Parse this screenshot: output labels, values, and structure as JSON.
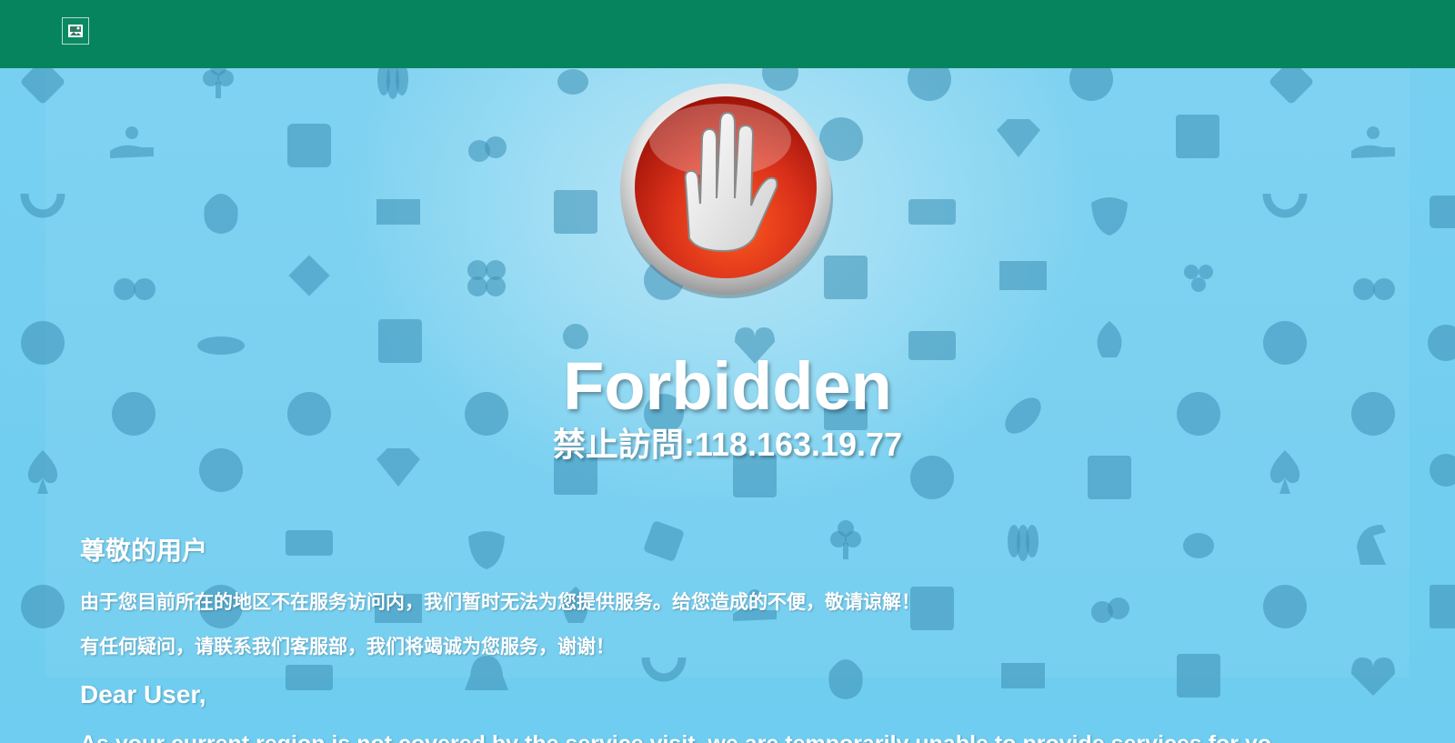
{
  "header": {
    "logo_icon": "broken-image-icon",
    "bar_color": "#06845e"
  },
  "background": {
    "pattern_icons": [
      "dice-icon",
      "club-icon",
      "bowling-icon",
      "lemon-icon",
      "eight-ball-icon",
      "yen-coin-icon",
      "poker-chip-icon",
      "coin-hand-icon",
      "cherries-icon",
      "tennis-ball-icon",
      "diamond-icon",
      "bingo-card-icon",
      "horseshoe-icon",
      "money-bag-icon",
      "lucky-777-icon",
      "ticket-icon",
      "strawberry-icon",
      "cherry-icon",
      "clover-icon",
      "dollar-bill-icon",
      "grapes-icon",
      "volleyball-icon",
      "roulette-icon",
      "bar-icon",
      "bell-icon",
      "heart-icon",
      "football-icon",
      "soccer-ball-icon",
      "spade-icon",
      "basketball-icon",
      "chess-knight-icon"
    ],
    "color": "#6fcdf0"
  },
  "error": {
    "icon": "stop-hand-icon",
    "title": "Forbidden",
    "subtitle": "禁止訪問:118.163.19.77"
  },
  "message": {
    "cn_heading": "尊敬的用户",
    "cn_line1": "由于您目前所在的地区不在服务访问内，我们暂时无法为您提供服务。给您造成的不便，敬请谅解！",
    "cn_line2": "有任何疑问，请联系我们客服部，我们将竭诚为您服务，谢谢！",
    "en_heading": "Dear User,",
    "en_line1": "As your current region is not covered by the service visit, we are temporarily unable to provide services for yo"
  }
}
